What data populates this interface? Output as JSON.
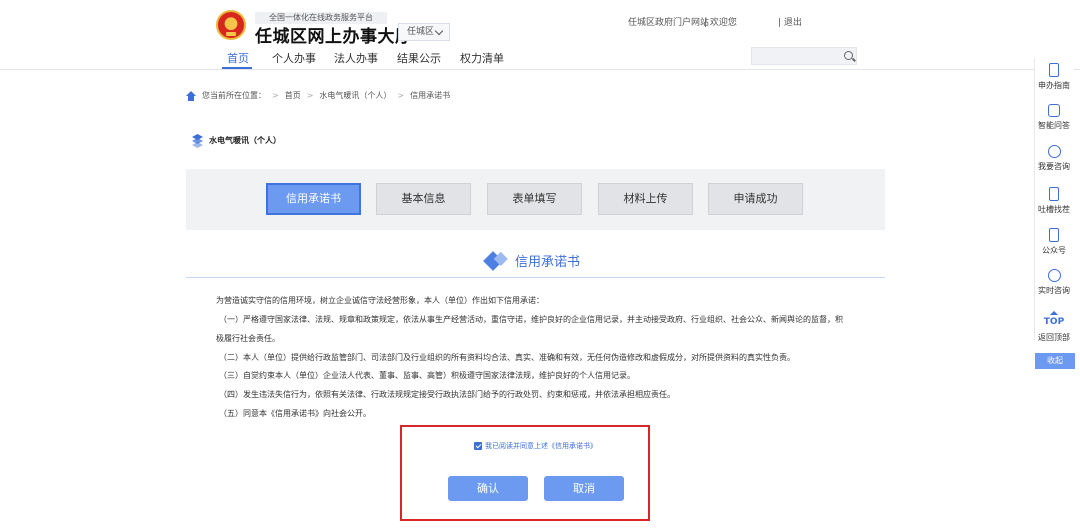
{
  "header": {
    "tagline": "全国一体化在线政务服务平台",
    "title": "任城区网上办事大厅",
    "region": "任城区",
    "portal_link": "任城区政府门户网站",
    "welcome": "| 欢迎您",
    "logout": "| 退出"
  },
  "nav": {
    "items": [
      "首页",
      "个人办事",
      "法人办事",
      "结果公示",
      "权力清单"
    ],
    "active": "首页"
  },
  "search": {
    "placeholder": ""
  },
  "breadcrumb": {
    "label": "您当前所在位置：",
    "items": [
      "首页",
      "水电气暖讯（个人）",
      "信用承诺书"
    ],
    "sep": ">"
  },
  "service": {
    "title": "水电气暖讯（个人）"
  },
  "steps": [
    {
      "label": "信用承诺书",
      "active": true
    },
    {
      "label": "基本信息",
      "active": false
    },
    {
      "label": "表单填写",
      "active": false
    },
    {
      "label": "材料上传",
      "active": false
    },
    {
      "label": "申请成功",
      "active": false
    }
  ],
  "section": {
    "title": "信用承诺书"
  },
  "commitment": {
    "intro": "为营造诚实守信的信用环境，树立企业诚信守法经营形象，本人（单位）作出如下信用承诺：",
    "item1a": "（一）严格遵守国家法律、法规、规章和政策规定，依法从事生产经营活动，重信守诺，维护良好的企业信用记录，并主动接受政府、行业组织、社会公众、新闻舆论的监督，积",
    "item1b": "极履行社会责任。",
    "item2": "（二）本人（单位）提供给行政监管部门、司法部门及行业组织的所有资料均合法、真实、准确和有效，无任何伪造修改和虚假成分，对所提供资料的真实性负责。",
    "item3": "（三）自觉约束本人（单位）企业法人代表、董事、监事、高管）积极遵守国家法律法规，维护良好的个人信用记录。",
    "item4": "（四）发生违法失信行为，依照有关法律、行政法规规定接受行政执法部门给予的行政处罚、约束和惩戒，并依法承担相应责任。",
    "item5": "（五）同意本《信用承诺书》向社会公开。"
  },
  "agree": {
    "label": "我已阅读并同意上述《信用承诺书》",
    "checked": true
  },
  "buttons": {
    "confirm": "确认",
    "cancel": "取消"
  },
  "sidebar": {
    "items": [
      {
        "label": "申办指南",
        "icon": "phone-icon"
      },
      {
        "label": "智能问答",
        "icon": "robot-icon"
      },
      {
        "label": "我要咨询",
        "icon": "headset-icon"
      },
      {
        "label": "吐槽找茬",
        "icon": "phone-icon"
      },
      {
        "label": "公众号",
        "icon": "phone-icon"
      },
      {
        "label": "实时咨询",
        "icon": "chat-icon"
      },
      {
        "label": "返回顶部",
        "icon": "top-icon",
        "icon_text": "TOP"
      }
    ],
    "collapse": "收起"
  },
  "colors": {
    "accent": "#3c6fd8",
    "button": "#6b9af0",
    "highlight_border": "#d9252a"
  }
}
